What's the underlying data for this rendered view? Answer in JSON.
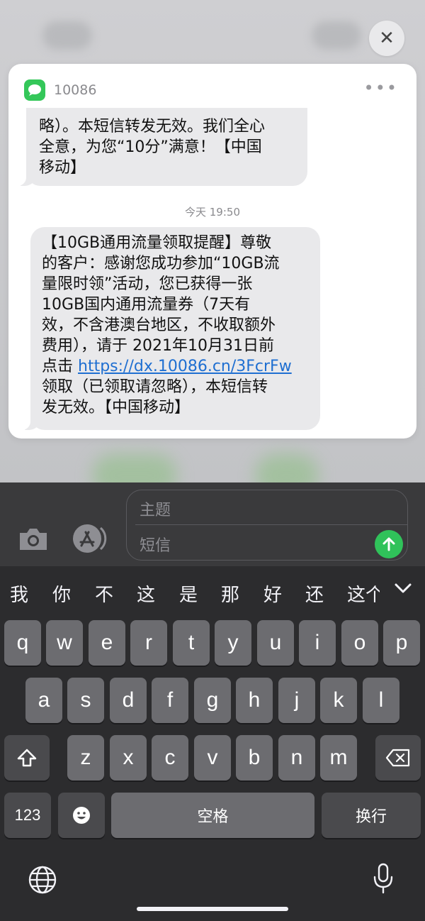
{
  "notification": {
    "sender": "10086",
    "more_label": "•••",
    "close_label": "✕",
    "prev_message_lines": [
      "略）。本短信转发无效。我们全心",
      "全意，为您“10分”满意！【中国",
      "移动】"
    ],
    "timestamp": "今天 19:50",
    "message_lines": [
      "【10GB通用流量领取提醒】尊敬",
      "的客户：感谢您成功参加“10GB流",
      "量限时领”活动，您已获得一张",
      "10GB国内通用流量券（7天有",
      "效，不含港澳台地区，不收取额外",
      "费用），请于 2021年10月31日前"
    ],
    "link_prefix": "点击 ",
    "link": "https://dx.10086.cn/3FcrFw",
    "message_tail_lines": [
      "领取（已领取请忽略），本短信转",
      "发无效。【中国移动】"
    ]
  },
  "compose": {
    "subject_placeholder": "主题",
    "body_placeholder": "短信"
  },
  "keyboard": {
    "candidates": [
      "我",
      "你",
      "不",
      "这",
      "是",
      "那",
      "好",
      "还",
      "这个"
    ],
    "row1": [
      "q",
      "w",
      "e",
      "r",
      "t",
      "y",
      "u",
      "i",
      "o",
      "p"
    ],
    "row2": [
      "a",
      "s",
      "d",
      "f",
      "g",
      "h",
      "j",
      "k",
      "l"
    ],
    "row3": [
      "z",
      "x",
      "c",
      "v",
      "b",
      "n",
      "m"
    ],
    "numbers_key": "123",
    "space_key": "空格",
    "return_key": "换行"
  },
  "colors": {
    "send_button": "#30c25a",
    "link": "#1f6fd1",
    "messages_icon": "#34c759"
  }
}
